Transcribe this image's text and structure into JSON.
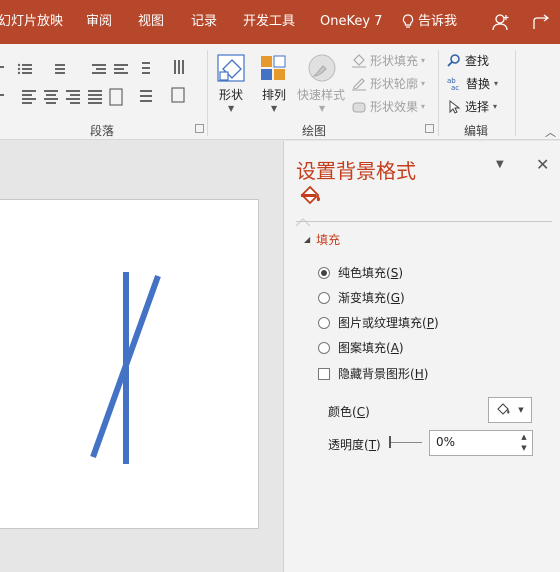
{
  "tabs": [
    {
      "label": "幻灯片放映"
    },
    {
      "label": "审阅"
    },
    {
      "label": "视图"
    },
    {
      "label": "记录"
    },
    {
      "label": "开发工具"
    },
    {
      "label": "OneKey 7"
    },
    {
      "label": "告诉我"
    }
  ],
  "ribbon": {
    "paragraph_label": "段落",
    "drawing_label": "绘图",
    "editing_label": "编辑",
    "shapes_label": "形状",
    "arrange_label": "排列",
    "quick_styles_label": "快速样式",
    "shape_fill_label": "形状填充",
    "shape_outline_label": "形状轮廓",
    "shape_effects_label": "形状效果",
    "find_label": "查找",
    "replace_label": "替换",
    "select_label": "选择"
  },
  "pane": {
    "title": "设置背景格式",
    "section": "填充",
    "options": [
      {
        "label": "纯色填充",
        "key": "S",
        "selected": true
      },
      {
        "label": "渐变填充",
        "key": "G",
        "selected": false
      },
      {
        "label": "图片或纹理填充",
        "key": "P",
        "selected": false
      },
      {
        "label": "图案填充",
        "key": "A",
        "selected": false
      }
    ],
    "hide_bg": {
      "label": "隐藏背景图形",
      "key": "H",
      "checked": false
    },
    "color": {
      "label": "颜色",
      "key": "C"
    },
    "transparency": {
      "label": "透明度",
      "key": "T",
      "value": "0%"
    }
  },
  "colors": {
    "accent": "#b7472a",
    "pane_title": "#c43e1c",
    "shape": "#4472c4"
  }
}
